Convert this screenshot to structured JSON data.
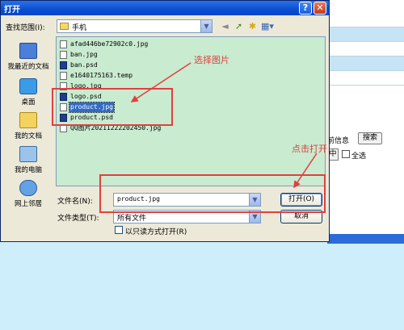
{
  "window": {
    "title": "打开",
    "help_glyph": "?",
    "close_glyph": "✕"
  },
  "background": {
    "search_label": "前信息",
    "search_button": "搜索",
    "partial_button": "中",
    "select_all_label": "全选"
  },
  "lookin": {
    "label": "查找范围(I):",
    "value": "手机"
  },
  "toolbar": {
    "back_icon": "◄",
    "up_icon": "➚",
    "newfolder_icon": "✱",
    "view_icon": "▦▾"
  },
  "places": [
    {
      "label": "我最近的文档",
      "icon": "recent-documents-icon"
    },
    {
      "label": "桌面",
      "icon": "desktop-icon"
    },
    {
      "label": "我的文档",
      "icon": "my-documents-icon"
    },
    {
      "label": "我的电脑",
      "icon": "my-computer-icon"
    },
    {
      "label": "网上邻居",
      "icon": "network-places-icon"
    }
  ],
  "files": [
    {
      "name": "afad446be72902c0.jpg",
      "type": "jpg"
    },
    {
      "name": "ban.jpg",
      "type": "jpg"
    },
    {
      "name": "ban.psd",
      "type": "psd"
    },
    {
      "name": "e1640175163.temp",
      "type": "temp"
    },
    {
      "name": "logo.jpg",
      "type": "jpg"
    },
    {
      "name": "logo.psd",
      "type": "psd"
    },
    {
      "name": "product.jpg",
      "type": "jpg",
      "selected": true
    },
    {
      "name": "product.psd",
      "type": "psd"
    },
    {
      "name": "QQ图片20211222202450.jpg",
      "type": "jpg"
    }
  ],
  "annotations": {
    "select_image": "选择图片",
    "click_open": "点击打开"
  },
  "filename": {
    "label": "文件名(N):",
    "value": "product.jpg"
  },
  "filetype": {
    "label": "文件类型(T):",
    "value": "所有文件"
  },
  "buttons": {
    "open": "打开(O)",
    "cancel": "取消"
  },
  "readonly": {
    "label": "以只读方式打开(R)"
  },
  "colors": {
    "annotation": "#e04040",
    "selection": "#316ac5",
    "filelist_bg": "#c9ebd0",
    "titlebar": "#0a4ed2"
  }
}
